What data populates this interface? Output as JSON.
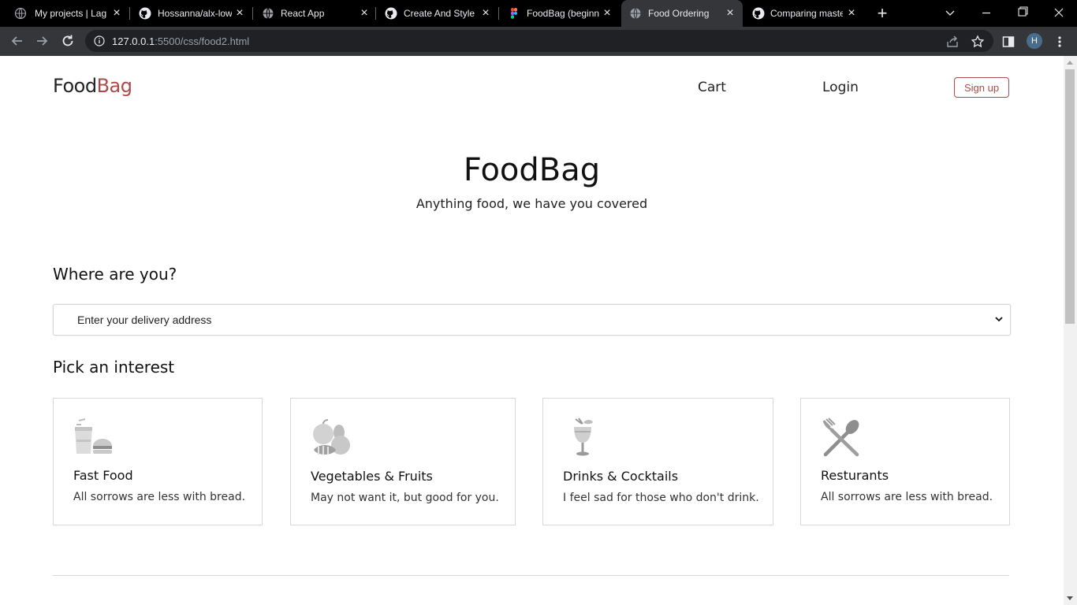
{
  "browser": {
    "tabs": [
      {
        "title": "My projects | Lag",
        "icon": "globe-icon",
        "active": false
      },
      {
        "title": "Hossanna/alx-low",
        "icon": "github-icon",
        "active": false
      },
      {
        "title": "React App",
        "icon": "globe-icon",
        "active": false
      },
      {
        "title": "Create And Style",
        "icon": "github-icon",
        "active": false
      },
      {
        "title": "FoodBag (beginn",
        "icon": "figma-icon",
        "active": false
      },
      {
        "title": "Food Ordering",
        "icon": "globe-icon",
        "active": true
      },
      {
        "title": "Comparing maste",
        "icon": "github-icon",
        "active": false
      }
    ],
    "url_host": "127.0.0.1",
    "url_path": ":5500/css/food2.html",
    "profile_initial": "H"
  },
  "page": {
    "logo_food": "Food",
    "logo_bag": "Bag",
    "nav": {
      "cart": "Cart",
      "login": "Login",
      "signup": "Sign up"
    },
    "hero": {
      "title": "FoodBag",
      "subtitle": "Anything food, we have you covered"
    },
    "location": {
      "heading": "Where are you?",
      "placeholder": "Enter your delivery address"
    },
    "interest": {
      "heading": "Pick an interest",
      "cards": [
        {
          "title": "Fast Food",
          "desc": "All sorrows are less with bread.",
          "icon": "fast-food-icon"
        },
        {
          "title": "Vegetables & Fruits",
          "desc": "May not want it, but good for you.",
          "icon": "vegetables-fruits-icon"
        },
        {
          "title": "Drinks & Cocktails",
          "desc": "I feel sad for those who don't drink.",
          "icon": "cocktail-icon"
        },
        {
          "title": "Resturants",
          "desc": "All sorrows are less with bread.",
          "icon": "fork-spoon-icon"
        }
      ]
    },
    "colors": {
      "brand": "#b04a4a",
      "text": "#111111",
      "card_border": "#d8d8d8"
    }
  }
}
